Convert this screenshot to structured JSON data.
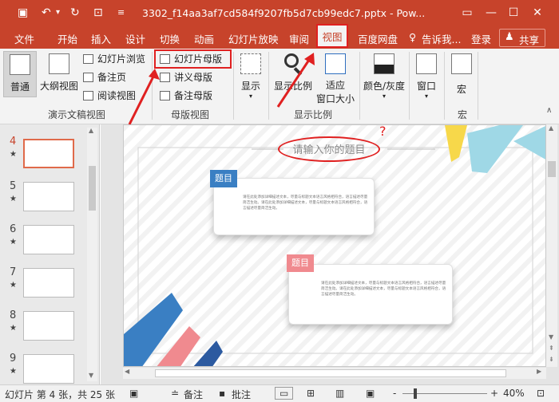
{
  "app": {
    "title": "3302_f14aa3af7cd584f9207fb5d7cb99edc7.pptx - Pow...",
    "save_icon": "save-icon",
    "undo_icon": "undo-icon",
    "redo_icon": "redo-icon",
    "present_icon": "present-icon",
    "customize_icon": "customize-icon"
  },
  "tabs": [
    "文件",
    "开始",
    "插入",
    "设计",
    "切换",
    "动画",
    "幻灯片放映",
    "审阅",
    "视图",
    "百度网盘"
  ],
  "tell_me": "告诉我...",
  "login": "登录",
  "share": "共享",
  "ribbon": {
    "groups": {
      "presentation_views": "演示文稿视图",
      "master_views": "母版视图",
      "zoom": "显示比例"
    },
    "normal": "普通",
    "outline": "大纲视图",
    "slide_sorter": "幻灯片浏览",
    "notes_page": "备注页",
    "reading_view": "阅读视图",
    "slide_master": "幻灯片母版",
    "handout_master": "讲义母版",
    "notes_master": "备注母版",
    "show": "显示",
    "zoom": "显示比例",
    "fit_window_1": "适应",
    "fit_window_2": "窗口大小",
    "color_gray": "颜色/灰度",
    "window": "窗口",
    "macros": "宏",
    "macros_group": "宏"
  },
  "thumbnails": [
    {
      "num": "4",
      "star": "★"
    },
    {
      "num": "5",
      "star": "★"
    },
    {
      "num": "6",
      "star": "★"
    },
    {
      "num": "7",
      "star": "★"
    },
    {
      "num": "8",
      "star": "★"
    },
    {
      "num": "9",
      "star": "★"
    }
  ],
  "slide": {
    "title": "请输入你的题目",
    "question": "?",
    "card1_tag": "题目",
    "card1_text": "请在此处添加详细描述文本，尽量与标题文本语言风格相符合，语言描述尽量简洁生动。请在此处添加详细描述文本，尽量与标题文本语言风格相符合，语言描述尽量简洁生动。",
    "card2_tag": "题目",
    "card2_text": "请在此处添加详细描述文本，尽量与标题文本语言风格相符合，语言描述尽量简洁生动。请在此处添加详细描述文本，尽量与标题文本语言风格相符合，语言描述尽量简洁生动。"
  },
  "status": {
    "slide_info": "幻灯片 第 4 张，共 25 张",
    "notes": "备注",
    "comments": "批注",
    "zoom_minus": "-",
    "zoom_plus": "+",
    "zoom": "40%"
  },
  "colors": {
    "accent": "#c7432b",
    "highlight": "#e02020",
    "tag_blue": "#3a7fc3",
    "tag_pink": "#f08a8f"
  }
}
